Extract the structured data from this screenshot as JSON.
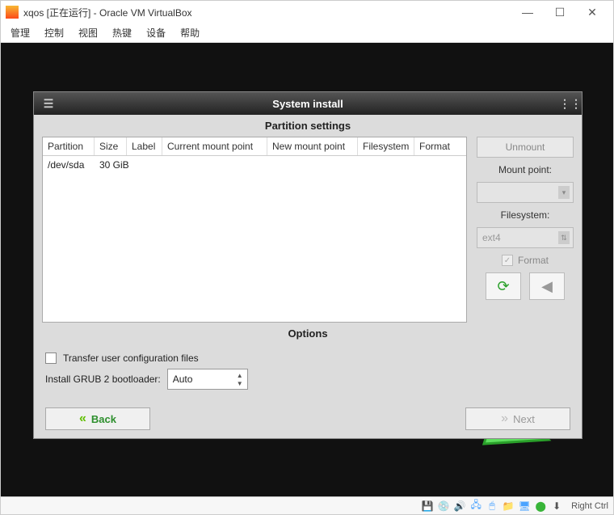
{
  "vbox": {
    "title": "xqos [正在运行] - Oracle VM VirtualBox",
    "menu": [
      "管理",
      "控制",
      "视图",
      "热键",
      "设备",
      "帮助"
    ],
    "win_buttons": {
      "min": "—",
      "max": "☐",
      "close": "✕"
    },
    "status_host_key": "Right Ctrl"
  },
  "installer": {
    "title": "System install",
    "partition_header": "Partition settings",
    "columns": [
      "Partition",
      "Size",
      "Label",
      "Current mount point",
      "New mount point",
      "Filesystem",
      "Format"
    ],
    "rows": [
      {
        "partition": "/dev/sda",
        "size": "30 GiB",
        "label": "",
        "current_mp": "",
        "new_mp": "",
        "fs": "",
        "format": ""
      }
    ],
    "side": {
      "unmount": "Unmount",
      "mount_label": "Mount point:",
      "mount_value": "",
      "fs_label": "Filesystem:",
      "fs_value": "ext4",
      "format_label": "Format"
    },
    "options": {
      "header": "Options",
      "transfer": "Transfer user configuration files",
      "grub_label": "Install GRUB 2 bootloader:",
      "grub_value": "Auto"
    },
    "nav": {
      "back": "Back",
      "next": "Next"
    }
  }
}
